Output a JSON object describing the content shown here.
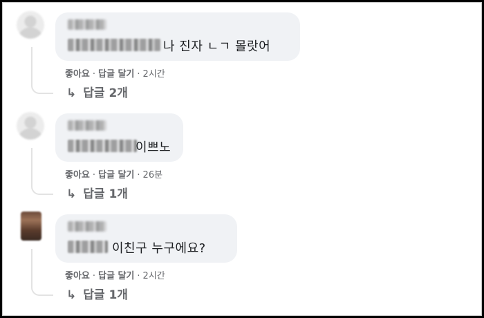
{
  "comments": [
    {
      "author": "",
      "text": "나 진자 ㄴㄱ 몰랏어",
      "actions": {
        "like": "좋아요",
        "reply": "답글 달기",
        "sep": "·",
        "time": "2시간"
      },
      "replies": "답글 2개"
    },
    {
      "author": "",
      "text": "이쁘노",
      "actions": {
        "like": "좋아요",
        "reply": "답글 달기",
        "sep": "·",
        "time": "26분"
      },
      "replies": "답글 1개"
    },
    {
      "author": "",
      "text": "이친구 누구에요?",
      "actions": {
        "like": "좋아요",
        "reply": "답글 달기",
        "sep": "·",
        "time": "2시간"
      },
      "replies": "답글 1개"
    }
  ],
  "icons": {
    "reply_arrow": "↳"
  }
}
